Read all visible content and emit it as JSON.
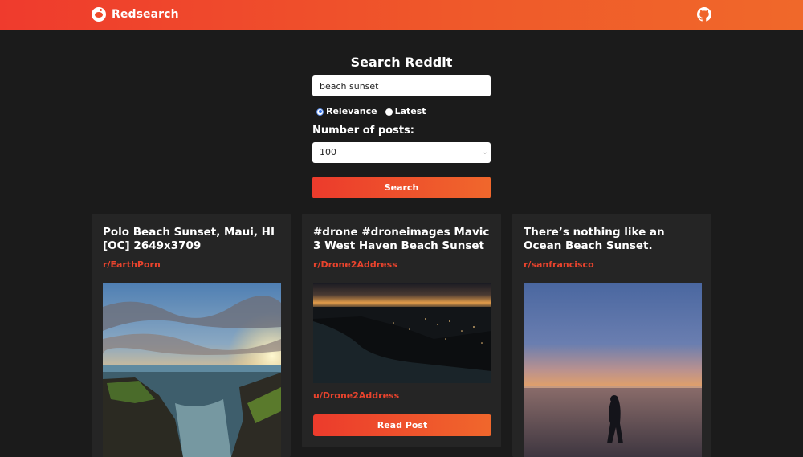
{
  "app": {
    "name": "Redsearch",
    "logo_icon": "reddit-icon",
    "github_icon": "github-icon"
  },
  "search": {
    "title": "Search Reddit",
    "query": "beach sunset",
    "sort_options": [
      {
        "label": "Relevance",
        "checked": true
      },
      {
        "label": "Latest",
        "checked": false
      }
    ],
    "num_posts_label": "Number of posts:",
    "num_posts_value": "100",
    "button_label": "Search"
  },
  "posts": [
    {
      "title": "Polo Beach Sunset, Maui, HI [OC] 2649x3709",
      "subreddit": "r/EarthPorn"
    },
    {
      "title": "#drone #droneimages Mavic 3 West Haven Beach Sunset",
      "subreddit": "r/Drone2Address",
      "author": "u/Drone2Address",
      "button_label": "Read Post"
    },
    {
      "title": "There’s nothing like an Ocean Beach Sunset.",
      "subreddit": "r/sanfrancisco"
    }
  ],
  "colors": {
    "accent": "#ef4a2b",
    "background": "#1b1b1b",
    "card": "#252525"
  }
}
